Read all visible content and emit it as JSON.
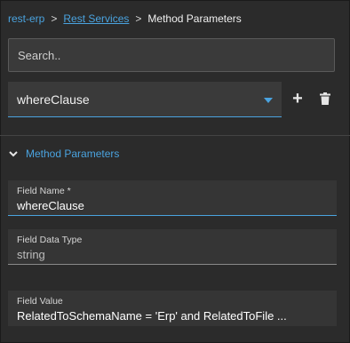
{
  "breadcrumb": {
    "root": "rest-erp",
    "separator": ">",
    "parent": "Rest Services",
    "current": "Method Parameters"
  },
  "search": {
    "placeholder": "Search.."
  },
  "selector": {
    "value": "whereClause"
  },
  "toolbar": {
    "add_label": "+"
  },
  "section": {
    "title": "Method Parameters"
  },
  "fields": [
    {
      "label": "Field Name *",
      "value": "whereClause"
    },
    {
      "label": "Field Data Type",
      "value": "string"
    },
    {
      "label": "Field Value",
      "value": "RelatedToSchemaName = 'Erp' and RelatedToFile ..."
    }
  ],
  "colors": {
    "accent": "#4aa3df",
    "background": "#2b2b2b",
    "field_background": "#353535"
  }
}
